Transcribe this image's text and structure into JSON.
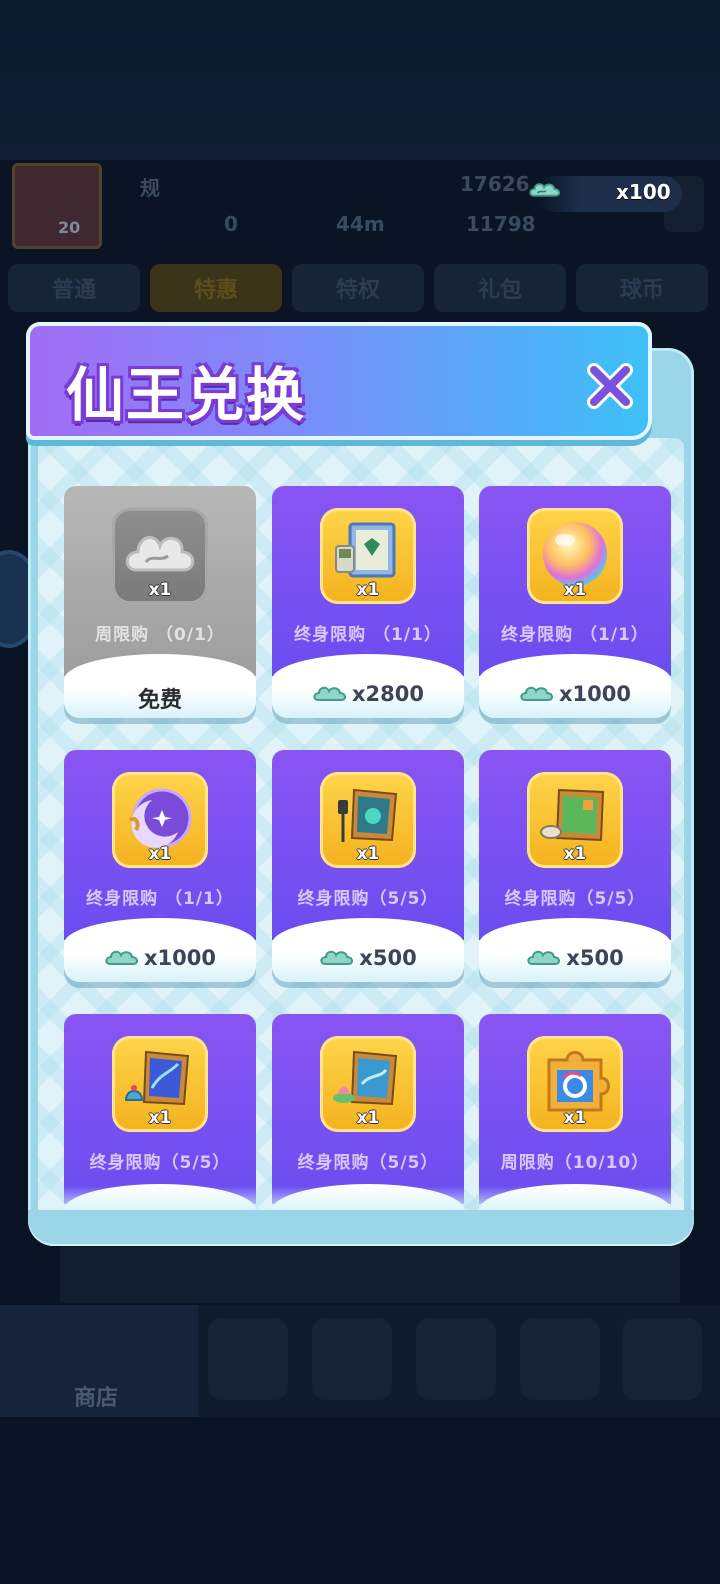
{
  "background": {
    "profile": {
      "name": "规",
      "level": "20",
      "trophy": "17626",
      "coins_zero": "0",
      "distance": "44m",
      "score": "11798"
    },
    "currency": {
      "icon": "cloud-currency-icon",
      "amount": "x100"
    },
    "tabs": [
      {
        "label": "普通"
      },
      {
        "label": "特惠"
      },
      {
        "label": "特权"
      },
      {
        "label": "礼包"
      },
      {
        "label": "球币"
      }
    ],
    "bottom_nav": {
      "shop_label": "商店"
    }
  },
  "modal": {
    "title": "仙王兑换",
    "close_icon": "close-icon",
    "items": [
      {
        "icon": "cloud-currency-icon",
        "qty": "x1",
        "limit": "周限购 （0/1）",
        "price": "免费",
        "free": true
      },
      {
        "icon": "framed-gem-picture-icon",
        "qty": "x1",
        "limit": "终身限购 （1/1）",
        "price": "x2800"
      },
      {
        "icon": "rainbow-orb-icon",
        "qty": "x1",
        "limit": "终身限购 （1/1）",
        "price": "x1000"
      },
      {
        "icon": "moon-orb-icon",
        "qty": "x1",
        "limit": "终身限购 （1/1）",
        "price": "x1000"
      },
      {
        "icon": "lantern-picture-icon",
        "qty": "x1",
        "limit": "终身限购（5/5）",
        "price": "x500"
      },
      {
        "icon": "green-picture-icon",
        "qty": "x1",
        "limit": "终身限购（5/5）",
        "price": "x500"
      },
      {
        "icon": "ocean-picture-icon",
        "qty": "x1",
        "limit": "终身限购（5/5）"
      },
      {
        "icon": "lotus-picture-icon",
        "qty": "x1",
        "limit": "终身限购（5/5）"
      },
      {
        "icon": "puzzle-piece-icon",
        "qty": "x1",
        "limit": "周限购（10/10）"
      }
    ]
  }
}
